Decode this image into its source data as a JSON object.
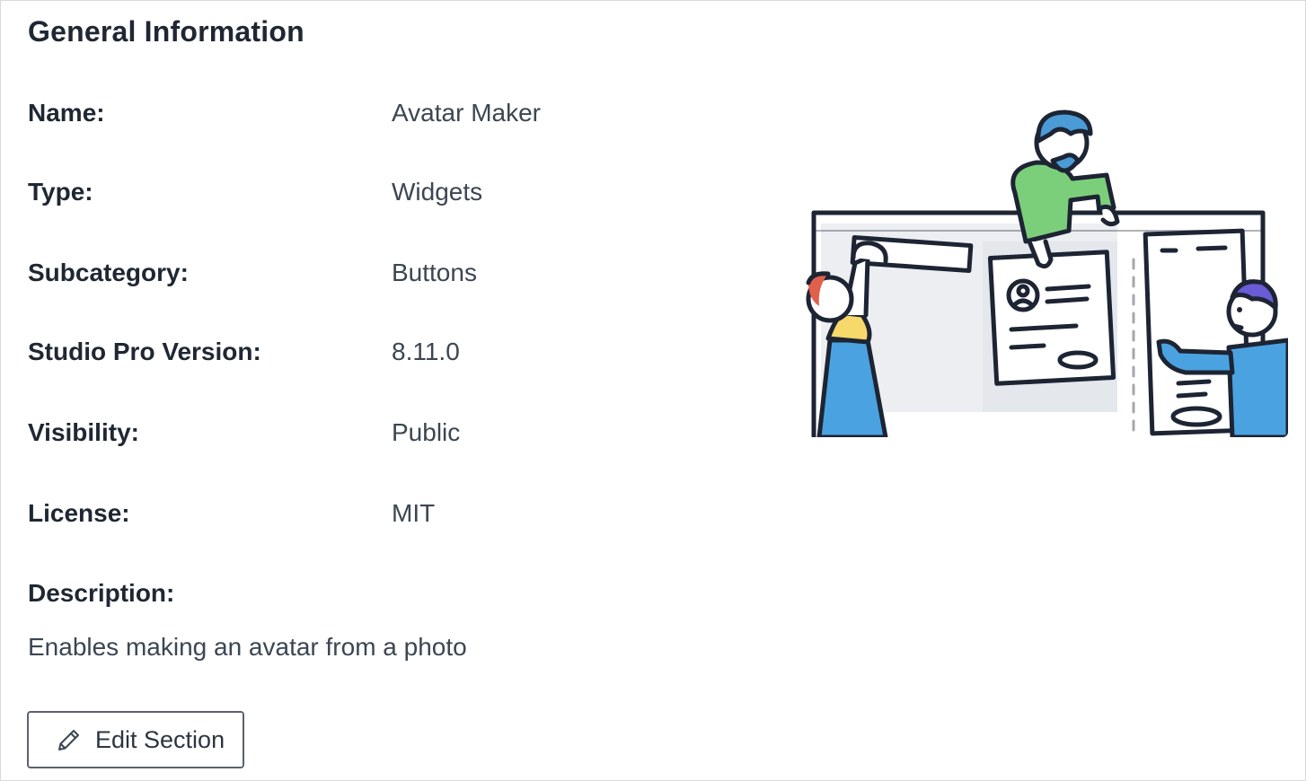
{
  "section": {
    "title": "General Information"
  },
  "fields": [
    {
      "label": "Name:",
      "value": "Avatar Maker"
    },
    {
      "label": "Type:",
      "value": "Widgets"
    },
    {
      "label": "Subcategory:",
      "value": "Buttons"
    },
    {
      "label": "Studio Pro Version:",
      "value": "8.11.0"
    },
    {
      "label": "Visibility:",
      "value": "Public"
    },
    {
      "label": "License:",
      "value": "MIT"
    }
  ],
  "description": {
    "label": "Description:",
    "text": "Enables making an avatar from a photo"
  },
  "actions": {
    "edit_label": "Edit Section",
    "edit_icon": "pencil-icon"
  },
  "illustration": {
    "name": "people-building-ui-illustration",
    "colors": {
      "outline": "#1d2433",
      "shirt_green": "#7ccf7a",
      "hair_blue": "#4a9bd6",
      "shirt_blue": "#4aa3e0",
      "dress_yellow": "#f6d86b",
      "skirt_blue": "#4aa3e0",
      "hair_red": "#e0604c",
      "hair_purple": "#6a5bd6",
      "panel_gray": "#eceef1"
    }
  }
}
